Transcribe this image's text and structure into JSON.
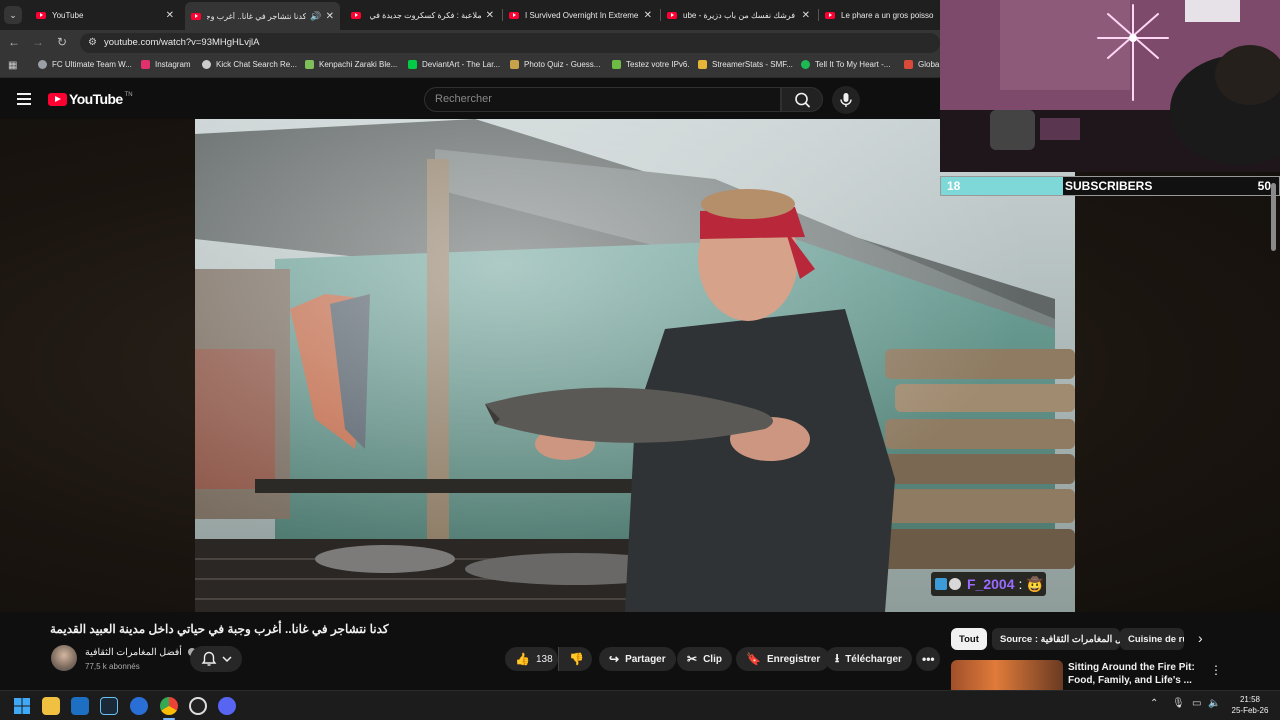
{
  "browser": {
    "tabs": [
      {
        "title": "YouTube"
      },
      {
        "title": "كدنا نتشاجر في غانا.. أغرب وجبة"
      },
      {
        "title": "ملاعبة : فكرة كسكروت جديدة في"
      },
      {
        "title": "I Survived Overnight In Extreme"
      },
      {
        "title": "ube - فرشك نفسك من باب دزيرة"
      },
      {
        "title": "Le phare a un gros poisson"
      }
    ],
    "url": "youtube.com/watch?v=93MHgHLvjlA",
    "bookmarks": [
      {
        "label": "FC Ultimate Team W...",
        "color": "#9aa0a6"
      },
      {
        "label": "Instagram",
        "color": "#e1306c"
      },
      {
        "label": "Kick Chat Search Re...",
        "color": "#cccccc"
      },
      {
        "label": "Kenpachi Zaraki Ble...",
        "color": "#7fbf5a"
      },
      {
        "label": "DeviantArt - The Lar...",
        "color": "#05cc47"
      },
      {
        "label": "Photo Quiz - Guess...",
        "color": "#c8a24a"
      },
      {
        "label": "Testez votre IPv6.",
        "color": "#6dbd45"
      },
      {
        "label": "StreamerStats - SMF...",
        "color": "#e5b53a"
      },
      {
        "label": "Tell It To My Heart -...",
        "color": "#1db954"
      },
      {
        "label": "Globa",
        "color": "#d94a3a"
      }
    ]
  },
  "youtube": {
    "logo_text": "YouTube",
    "logo_region": "TN",
    "search_placeholder": "Rechercher",
    "video_title": "كدنا نتشاجر في غانا.. أغرب وجبة في حياتي داخل مدينة العبيد القديمة",
    "channel_name": "أفضل المغامرات الثقافية",
    "subscribers": "77,5 k abonnés",
    "likes": "138",
    "actions": {
      "share": "Partager",
      "clip": "Clip",
      "save": "Enregistrer",
      "download": "Télécharger"
    },
    "chips": [
      {
        "label": "Tout",
        "active": true
      },
      {
        "label": "Source : أفضل المغامرات الثقافية",
        "active": false
      },
      {
        "label": "Cuisine de ru",
        "active": false
      }
    ],
    "related": {
      "title": "Sitting Around the Fire Pit: Food, Family, and Life's ..."
    }
  },
  "overlay": {
    "sub_current": "18",
    "sub_label": "SUBSCRIBERS",
    "sub_goal": "50",
    "sub_progress": 0.36,
    "chat_user": "F_2004",
    "chat_sep": ":",
    "chat_emoji": "🤠"
  },
  "taskbar": {
    "time": "21:58",
    "date": "25-Feb-26"
  },
  "colors": {
    "accent": "#ff0033",
    "sub_fill": "#7fd8d8",
    "chat_name": "#9b6bff"
  }
}
